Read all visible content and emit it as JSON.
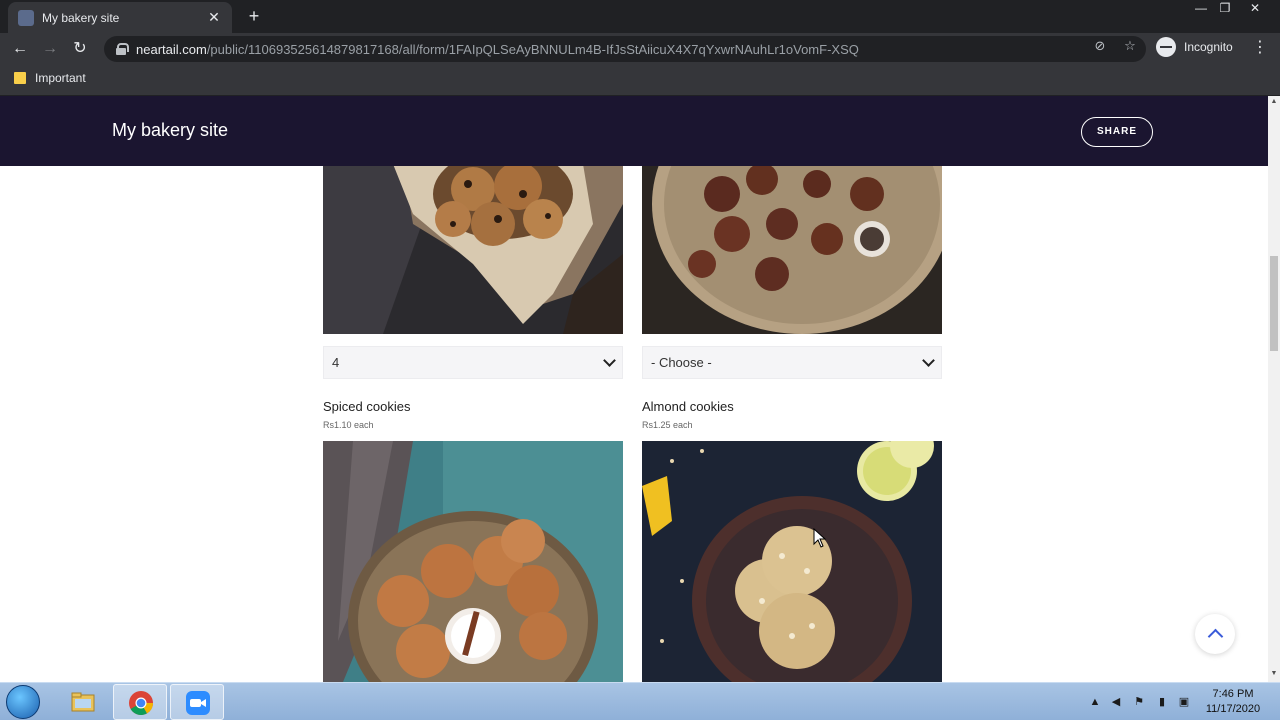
{
  "browser": {
    "tab_title": "My bakery site",
    "url_host": "neartail.com",
    "url_path": "/public/110693525614879817168/all/form/1FAIpQLSeAyBNNULm4B-IfJsStAiicuX4X7qYxwrNAuhLr1oVomF-XSQ",
    "profile_label": "Incognito",
    "bookmark_folder": "Important"
  },
  "site": {
    "title": "My bakery site",
    "share_label": "SHARE"
  },
  "products_top": [
    {
      "select_value": "4"
    },
    {
      "select_value": "- Choose -"
    }
  ],
  "products": [
    {
      "name": "Spiced cookies",
      "price": "Rs1.10 each"
    },
    {
      "name": "Almond cookies",
      "price": "Rs1.25 each"
    }
  ],
  "taskbar": {
    "time": "7:46 PM",
    "date": "11/17/2020"
  },
  "colors": {
    "header_bg": "#1b1530",
    "accent": "#3a5bd9"
  }
}
